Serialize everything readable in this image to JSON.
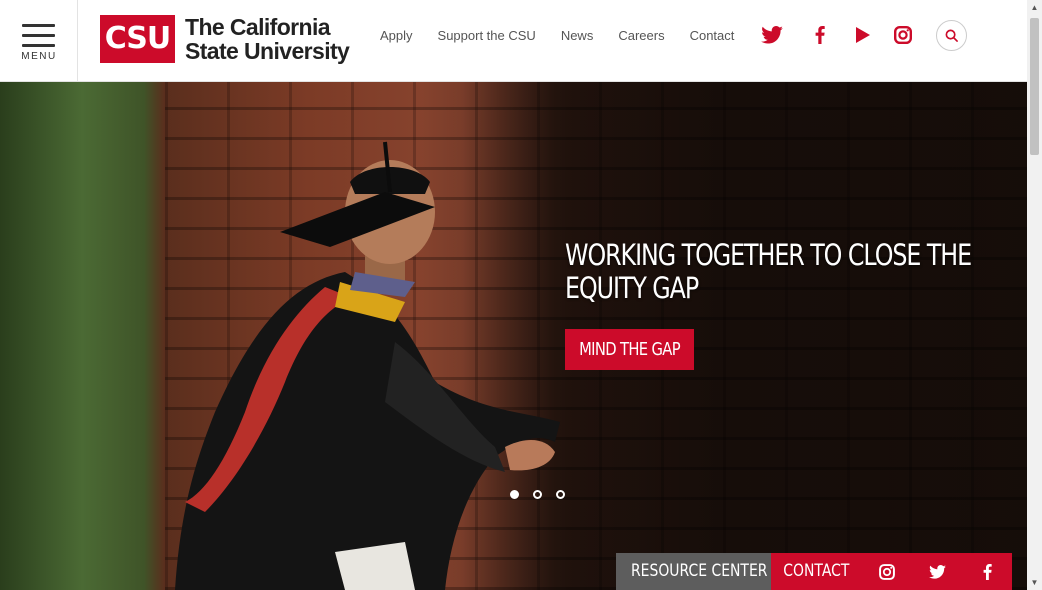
{
  "header": {
    "menu_label": "MENU",
    "logo": {
      "mark": "CSU",
      "line1": "The California",
      "line2": "State University"
    },
    "nav": [
      "Apply",
      "Support the CSU",
      "News",
      "Careers",
      "Contact"
    ],
    "social_icons": [
      "twitter-icon",
      "facebook-icon",
      "youtube-icon",
      "instagram-icon"
    ],
    "search_icon": "search-icon"
  },
  "hero": {
    "title": "WORKING TOGETHER TO CLOSE THE EQUITY GAP",
    "cta": "MIND THE GAP",
    "slides_count": 3,
    "active_slide": 1
  },
  "footer_bar": {
    "resource_center": "RESOURCE CENTER",
    "contact": "CONTACT",
    "icons": [
      "instagram-icon",
      "twitter-icon",
      "facebook-icon"
    ]
  },
  "colors": {
    "brand_red": "#cc0b2a",
    "dark_gray": "#5d5d5d"
  }
}
